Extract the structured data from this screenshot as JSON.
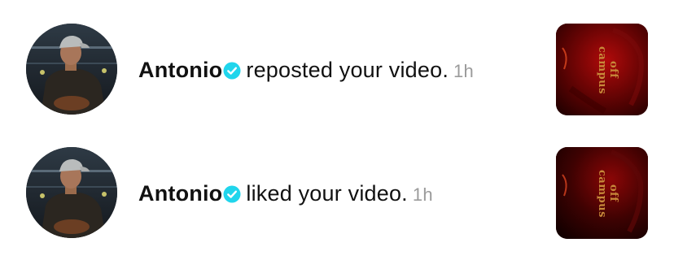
{
  "notifications": [
    {
      "username": "Antonio",
      "action": "reposted your video.",
      "time": "1h",
      "verified": true,
      "avatar_icon": "profile-photo",
      "thumbnail_caption": "off campus"
    },
    {
      "username": "Antonio",
      "action": "liked your video.",
      "time": "1h",
      "verified": true,
      "avatar_icon": "profile-photo",
      "thumbnail_caption": "off campus"
    }
  ],
  "colors": {
    "verified_badge": "#20D5EC",
    "timestamp": "#9B9B9B",
    "text": "#111111",
    "thumbnail_red": "#B00A0A"
  }
}
